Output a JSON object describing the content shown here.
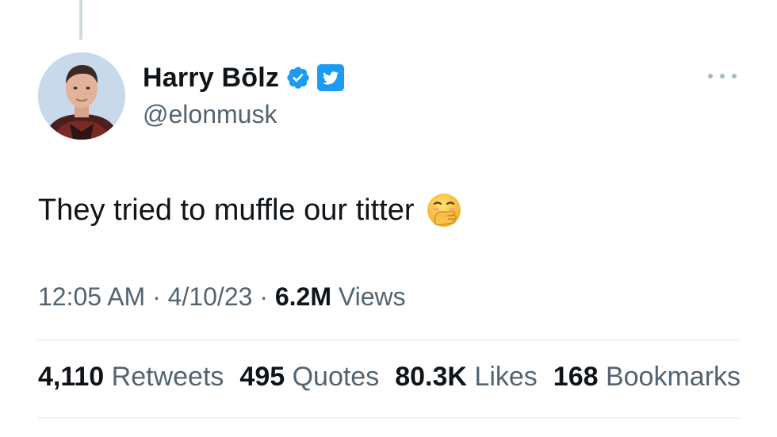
{
  "author": {
    "display_name": "Harry Bōlz",
    "handle": "@elonmusk",
    "verified": true
  },
  "icons": {
    "verified": "verified-badge-icon",
    "twitter": "twitter-bird-icon",
    "more": "more-options-icon",
    "emoji": "face-with-hand-over-mouth-emoji"
  },
  "tweet": {
    "text": "They tried to muffle our titter"
  },
  "meta": {
    "time": "12:05 AM",
    "date": "4/10/23",
    "views_count": "6.2M",
    "views_label": "Views",
    "separator": "·"
  },
  "stats": [
    {
      "count": "4,110",
      "label": "Retweets"
    },
    {
      "count": "495",
      "label": "Quotes"
    },
    {
      "count": "80.3K",
      "label": "Likes"
    },
    {
      "count": "168",
      "label": "Bookmarks"
    }
  ],
  "colors": {
    "primary_text": "#0f1419",
    "secondary_text": "#536471",
    "verified_blue": "#1d9bf0",
    "divider": "#eff3f4"
  }
}
